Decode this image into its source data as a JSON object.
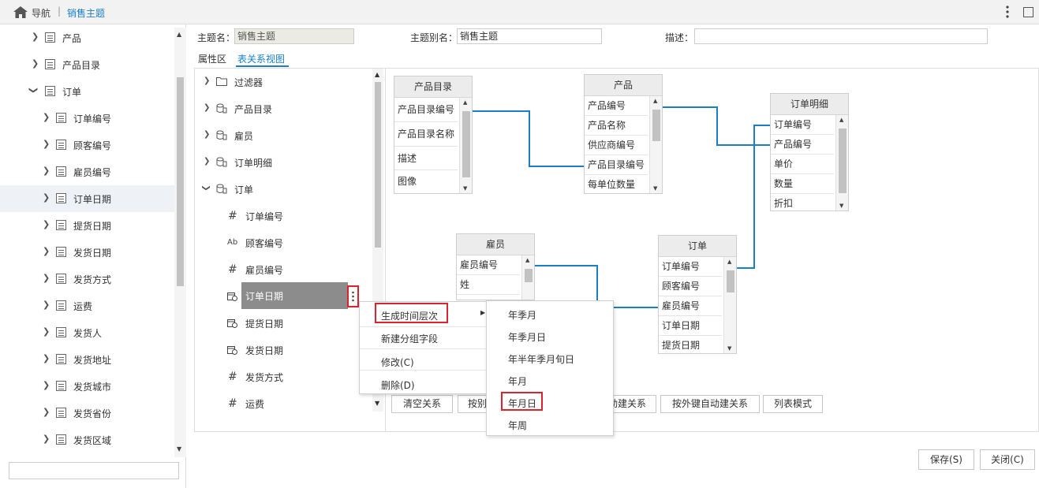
{
  "topbar": {
    "nav_label": "导航",
    "separator": "|",
    "title": "销售主题"
  },
  "left_tree": {
    "items": [
      {
        "label": "产品",
        "level": 0,
        "expanded": false
      },
      {
        "label": "产品目录",
        "level": 0,
        "expanded": false
      },
      {
        "label": "订单",
        "level": 0,
        "expanded": true
      },
      {
        "label": "订单编号",
        "level": 1
      },
      {
        "label": "顾客编号",
        "level": 1
      },
      {
        "label": "雇员编号",
        "level": 1
      },
      {
        "label": "订单日期",
        "level": 1,
        "selected": true
      },
      {
        "label": "提货日期",
        "level": 1
      },
      {
        "label": "发货日期",
        "level": 1
      },
      {
        "label": "发货方式",
        "level": 1
      },
      {
        "label": "运费",
        "level": 1
      },
      {
        "label": "发货人",
        "level": 1
      },
      {
        "label": "发货地址",
        "level": 1
      },
      {
        "label": "发货城市",
        "level": 1
      },
      {
        "label": "发货省份",
        "level": 1
      },
      {
        "label": "发货区域",
        "level": 1
      }
    ]
  },
  "header": {
    "topic_name_label": "主题名：",
    "topic_name_value": "销售主题",
    "alias_label": "主题别名：",
    "alias_value": "销售主题",
    "desc_label": "描述：",
    "desc_value": ""
  },
  "tabs": {
    "properties": "属性区",
    "relation_view": "表关系视图",
    "active": "表关系视图"
  },
  "field_tree": {
    "items": [
      {
        "label": "过滤器",
        "icon": "folder-icon",
        "chevron": "right"
      },
      {
        "label": "产品目录",
        "icon": "database-icon",
        "chevron": "right"
      },
      {
        "label": "雇员",
        "icon": "database-icon",
        "chevron": "right"
      },
      {
        "label": "订单明细",
        "icon": "database-icon",
        "chevron": "right"
      },
      {
        "label": "订单",
        "icon": "database-icon",
        "chevron": "down"
      },
      {
        "label": "订单编号",
        "icon": "#"
      },
      {
        "label": "顾客编号",
        "icon": "Ab"
      },
      {
        "label": "雇员编号",
        "icon": "#"
      },
      {
        "label": "订单日期",
        "icon": "date-icon",
        "selected": true
      },
      {
        "label": "提货日期",
        "icon": "date-icon"
      },
      {
        "label": "发货日期",
        "icon": "date-icon"
      },
      {
        "label": "发货方式",
        "icon": "#"
      },
      {
        "label": "运费",
        "icon": "#"
      }
    ]
  },
  "tables": {
    "product_catalog": {
      "title": "产品目录",
      "fields": [
        "产品目录编号",
        "产品目录名称",
        "描述",
        "图像"
      ]
    },
    "product": {
      "title": "产品",
      "fields": [
        "产品编号",
        "产品名称",
        "供应商编号",
        "产品目录编号",
        "每单位数量"
      ]
    },
    "order_detail": {
      "title": "订单明细",
      "fields": [
        "订单编号",
        "产品编号",
        "单价",
        "数量",
        "折扣"
      ]
    },
    "employee": {
      "title": "雇员",
      "fields": [
        "雇员编号",
        "姓"
      ]
    },
    "order": {
      "title": "订单",
      "fields": [
        "订单编号",
        "顾客编号",
        "雇员编号",
        "订单日期",
        "提货日期"
      ]
    }
  },
  "toolbar": {
    "clear": "清空关系",
    "by_name_partial": "按别",
    "auto_partial": "动建关系",
    "by_fk": "按外键自动建关系",
    "list_mode": "列表模式"
  },
  "context_menu": {
    "items": [
      "生成时间层次",
      "新建分组字段",
      "修改(C)",
      "删除(D)"
    ]
  },
  "submenu": {
    "items": [
      "年季月",
      "年季月日",
      "年半年季月旬日",
      "年月",
      "年月日",
      "年周"
    ]
  },
  "footer": {
    "save": "保存(S)",
    "close": "关闭(C)"
  },
  "colors": {
    "accent": "#1a7fc8",
    "link_line": "#1a7fc8",
    "highlight": "#d9232d",
    "selected_row": "#8c8c8c"
  }
}
